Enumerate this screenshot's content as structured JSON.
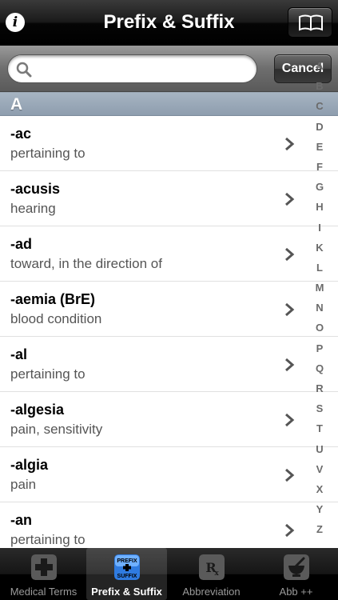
{
  "nav": {
    "title": "Prefix & Suffix",
    "info_label": "i"
  },
  "search": {
    "placeholder": "",
    "value": "",
    "cancel_label": "Cancel"
  },
  "section": {
    "letter": "A"
  },
  "rows": [
    {
      "term": "-ac",
      "meaning": "pertaining to"
    },
    {
      "term": "-acusis",
      "meaning": "hearing"
    },
    {
      "term": "-ad",
      "meaning": "toward, in the direction of"
    },
    {
      "term": "-aemia (BrE)",
      "meaning": "blood condition"
    },
    {
      "term": "-al",
      "meaning": "pertaining to"
    },
    {
      "term": "-algesia",
      "meaning": "pain, sensitivity"
    },
    {
      "term": "-algia",
      "meaning": "pain"
    },
    {
      "term": "-an",
      "meaning": "pertaining to"
    }
  ],
  "index": [
    "A",
    "B",
    "C",
    "D",
    "E",
    "F",
    "G",
    "H",
    "I",
    "K",
    "L",
    "M",
    "N",
    "O",
    "P",
    "Q",
    "R",
    "S",
    "T",
    "U",
    "V",
    "X",
    "Y",
    "Z"
  ],
  "tabs": [
    {
      "label": "Medical Terms",
      "icon": "cross-icon",
      "active": false
    },
    {
      "label": "Prefix & Suffix",
      "icon": "prefix-suffix-icon",
      "active": true
    },
    {
      "label": "Abbreviation",
      "icon": "rx-icon",
      "active": false
    },
    {
      "label": "Abb ++",
      "icon": "mortar-icon",
      "active": false
    }
  ],
  "colors": {
    "section_header": "#9aa8b8",
    "tab_active_text": "#ffffff",
    "tab_inactive_text": "#9a9a9a"
  }
}
